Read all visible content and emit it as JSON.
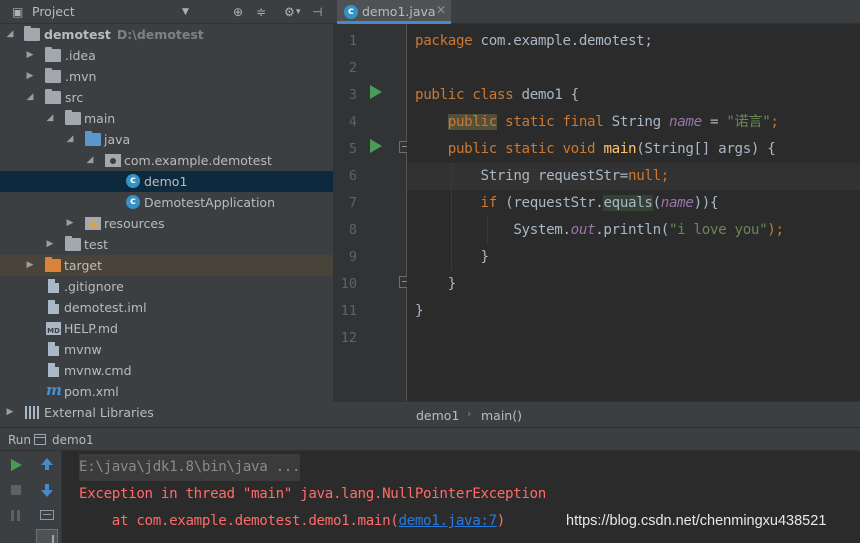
{
  "project_panel": {
    "title": "Project",
    "tree": [
      {
        "label": "demotest",
        "sub": "D:\\demotest"
      },
      {
        "label": ".idea"
      },
      {
        "label": ".mvn"
      },
      {
        "label": "src"
      },
      {
        "label": "main"
      },
      {
        "label": "java"
      },
      {
        "label": "com.example.demotest"
      },
      {
        "label": "demo1"
      },
      {
        "label": "DemotestApplication"
      },
      {
        "label": "resources"
      },
      {
        "label": "test"
      },
      {
        "label": "target"
      },
      {
        "label": ".gitignore"
      },
      {
        "label": "demotest.iml"
      },
      {
        "label": "HELP.md"
      },
      {
        "label": "mvnw"
      },
      {
        "label": "mvnw.cmd"
      },
      {
        "label": "pom.xml"
      },
      {
        "label": "External Libraries"
      }
    ]
  },
  "editor": {
    "tab_label": "demo1.java",
    "line_numbers": [
      "1",
      "2",
      "3",
      "4",
      "5",
      "6",
      "7",
      "8",
      "9",
      "10",
      "11",
      "12"
    ],
    "code": {
      "l1_kw": "package",
      "l1_rest": " com.example.demotest;",
      "l3_kw": "public class",
      "l3_rest": " demo1 {",
      "l4_kw1": "public",
      "l4_kw2": "static final",
      "l4_type": " String ",
      "l4_field": "name",
      "l4_eq": " = ",
      "l4_str": "\"诺言\"",
      "l4_semi": ";",
      "l5_kw": "public static void",
      "l5_fn": "main",
      "l5_rest": "(String[] args) {",
      "l6_text": "String requestStr=",
      "l6_kw": "null",
      "l6_semi": ";",
      "l7_kw": "if",
      "l7_a": " (requestStr.",
      "l7_method": "equals",
      "l7_b": "(",
      "l7_field": "name",
      "l7_c": ")){",
      "l8_a": "System.",
      "l8_field": "out",
      "l8_b": ".println(",
      "l8_str": "\"i love you\"",
      "l8_c": ");",
      "l9": "}",
      "l10": "}",
      "l11": "}"
    },
    "breadcrumbs": [
      "demo1",
      "main()"
    ]
  },
  "run_panel": {
    "title": "Run",
    "config": "demo1",
    "console": {
      "cmd": "E:\\java\\jdk1.8\\bin\\java ...",
      "error": "Exception in thread \"main\" java.lang.NullPointerException",
      "trace_prefix": "    at com.example.demotest.demo1.main(",
      "trace_link": "demo1.java:7",
      "trace_suffix": ")"
    }
  },
  "watermark": "https://blog.csdn.net/chenmingxu438521",
  "colors": {
    "accent": "#4a88c7",
    "error": "#ff6b68",
    "keyword": "#cc7832",
    "string": "#6a8759",
    "field": "#9876aa",
    "selection": "#0d293e"
  }
}
